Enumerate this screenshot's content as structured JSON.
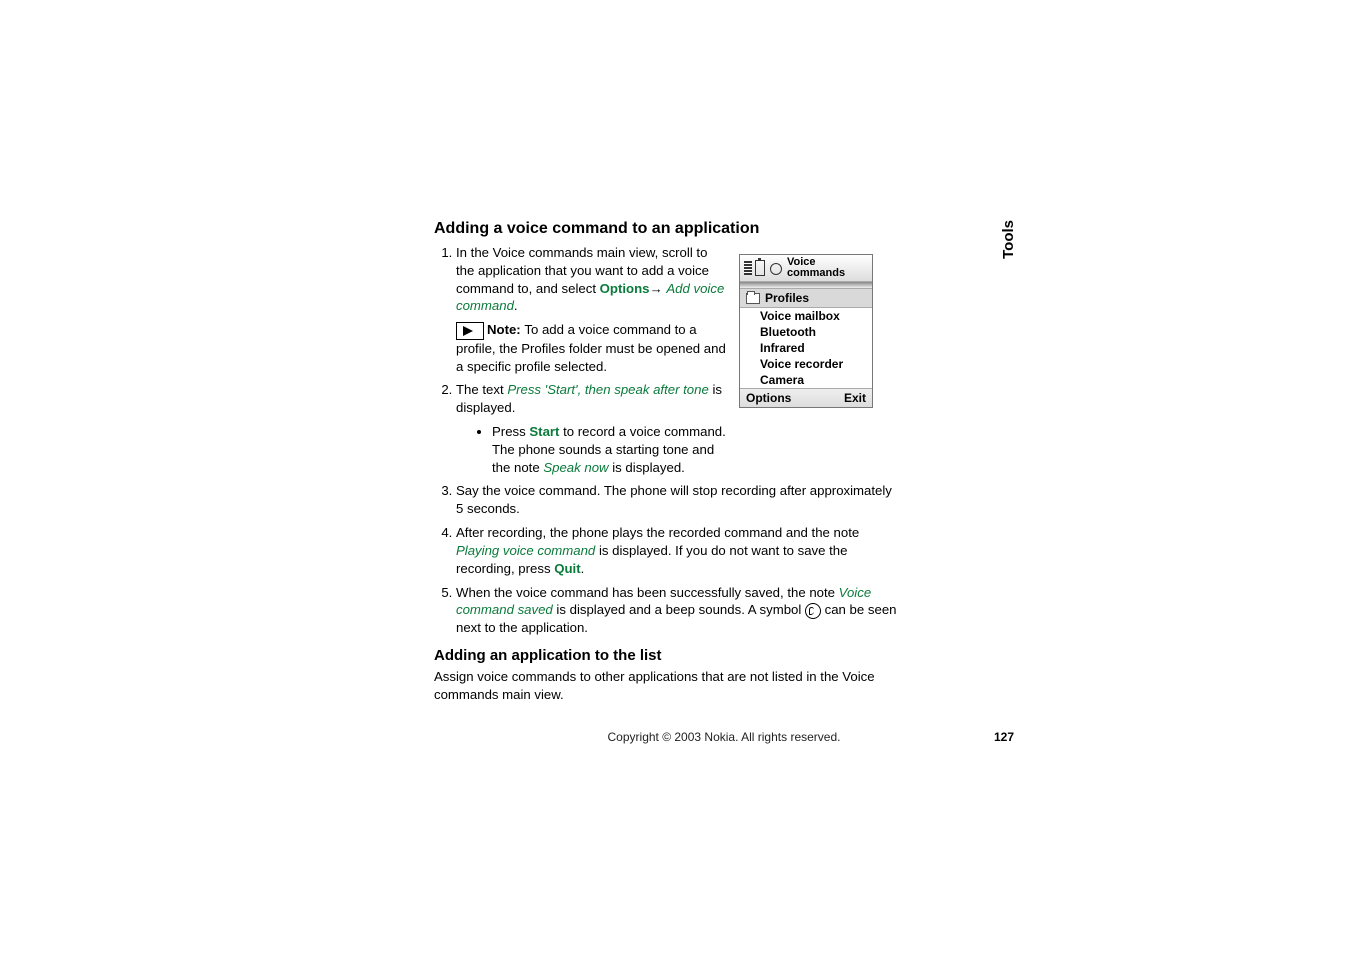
{
  "sideTab": "Tools",
  "heading1": "Adding a voice command to an application",
  "step1": {
    "pre": "In the Voice commands main view, scroll to the application that you want to add a voice command to, and select ",
    "options": "Options",
    "arrow": "→ ",
    "add": "Add voice command",
    "post": "."
  },
  "note": {
    "label": "Note:  ",
    "text": "To add a voice command to a profile, the Profiles folder must be opened and a specific profile selected."
  },
  "step2": {
    "pre": "The text ",
    "msg": "Press 'Start', then speak after tone",
    "post": " is displayed."
  },
  "step2bullet": {
    "pre": "Press ",
    "start": "Start",
    "mid": " to record a voice command. The phone sounds a starting tone and the note ",
    "speak": "Speak now",
    "post": " is displayed."
  },
  "step3": "Say the voice command. The phone will stop recording after approximately 5 seconds.",
  "step4": {
    "pre": "After recording, the phone plays the recorded command and the note ",
    "play": "Playing voice command",
    "mid": " is displayed. If you do not want to save the recording, press ",
    "quit": "Quit",
    "post": "."
  },
  "step5": {
    "pre": "When the voice command has been successfully saved, the note ",
    "saved": "Voice command saved",
    "mid": " is displayed and a beep sounds. A symbol ",
    "post": " can be seen next to the application."
  },
  "heading2": "Adding an application to the list",
  "para2": "Assign voice commands to other applications that are not listed in the Voice commands main view.",
  "screenshot": {
    "title1": "Voice",
    "title2": "commands",
    "category": "Profiles",
    "items": [
      "Voice mailbox",
      "Bluetooth",
      "Infrared",
      "Voice recorder",
      "Camera"
    ],
    "leftKey": "Options",
    "rightKey": "Exit"
  },
  "footer": {
    "copyright": "Copyright © 2003 Nokia. All rights reserved.",
    "page": "127"
  }
}
